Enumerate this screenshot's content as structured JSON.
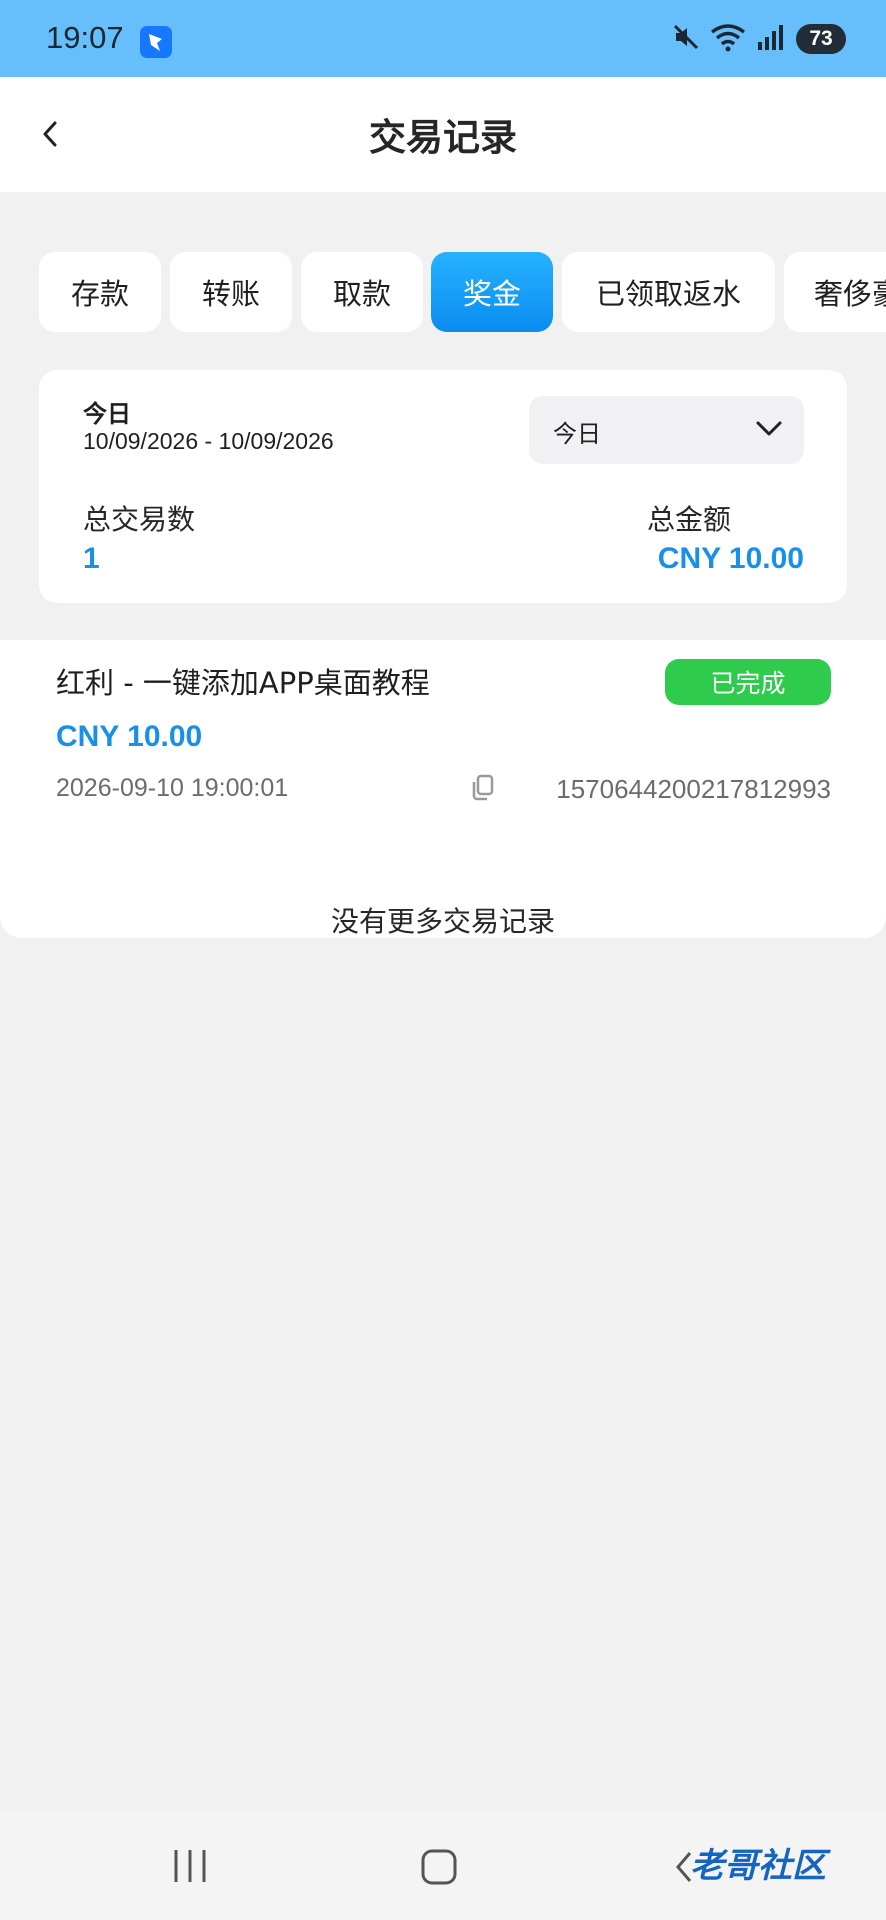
{
  "status_bar": {
    "time": "19:07",
    "battery": "73",
    "icons": [
      "app-icon",
      "mute-icon",
      "wifi-icon",
      "signal-icon",
      "battery-icon"
    ]
  },
  "header": {
    "title": "交易记录",
    "back_icon": "chevron-left-icon"
  },
  "tabs": [
    {
      "label": "存款",
      "active": false
    },
    {
      "label": "转账",
      "active": false
    },
    {
      "label": "取款",
      "active": false
    },
    {
      "label": "奖金",
      "active": true
    },
    {
      "label": "已领取返水",
      "active": false
    },
    {
      "label": "奢侈豪",
      "active": false
    }
  ],
  "summary": {
    "range_title": "今日",
    "range_dates": "10/09/2026 - 10/09/2026",
    "range_select_value": "今日",
    "total_count_label": "总交易数",
    "total_count": "1",
    "total_amount_label": "总金额",
    "total_amount": "CNY 10.00"
  },
  "records": [
    {
      "title": "红利 - 一键添加APP桌面教程",
      "status": "已完成",
      "amount": "CNY 10.00",
      "time": "2026-09-10 19:00:01",
      "id": "1570644200217812993"
    }
  ],
  "no_more_text": "没有更多交易记录",
  "watermark": "老哥社区",
  "colors": {
    "status_bar": "#66bffb",
    "accent": "#1890ea",
    "active_tab": "#0a8cf0",
    "success": "#2ecb4c"
  }
}
